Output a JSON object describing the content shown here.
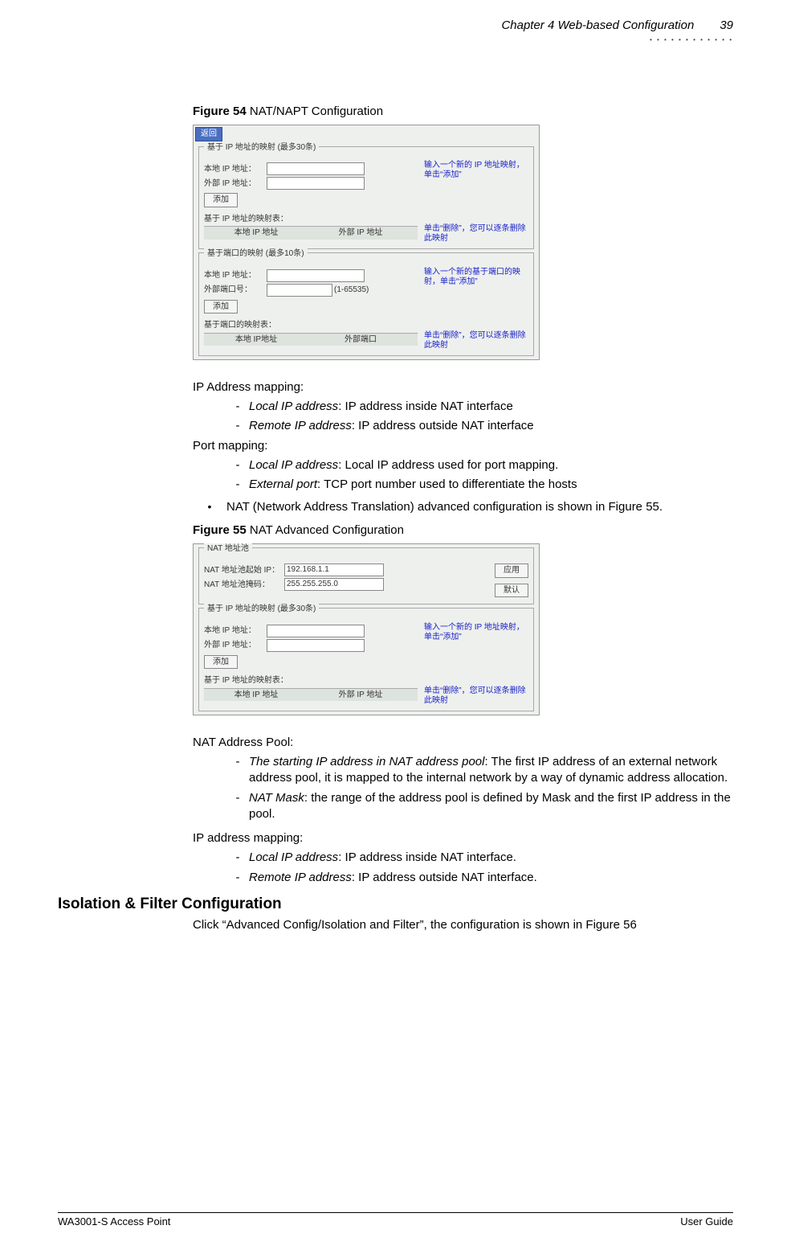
{
  "header": {
    "chapter": "Chapter 4 Web-based Configuration",
    "page": "39"
  },
  "fig54": {
    "label": "Figure 54",
    "title": " NAT/NAPT Configuration",
    "back": "返回",
    "ip_legend": "基于 IP 地址的映射 (最多30条)",
    "local_ip": "本地 IP 地址：",
    "remote_ip": "外部 IP 地址：",
    "add": "添加",
    "hint_add": "输入一个新的 IP 地址映射，单击“添加”",
    "table_title": "基于 IP 地址的映射表：",
    "th_local": "本地 IP 地址",
    "th_remote": "外部 IP 地址",
    "hint_delete": "单击“删除”，您可以逐条删除此映射",
    "port_legend": "基于端口的映射 (最多10条)",
    "port_local_ip": "本地 IP 地址：",
    "port_ext": "外部端口号：",
    "port_range": "(1-65535)",
    "port_hint_add": "输入一个新的基于端口的映射，单击“添加”",
    "port_table_title": "基于端口的映射表：",
    "port_th_local": "本地 IP地址",
    "port_th_ext": "外部端口",
    "port_hint_delete": "单击“删除”，您可以逐条删除此映射"
  },
  "text": {
    "ip_mapping": "IP Address mapping:",
    "ip_local_em": "Local IP address",
    "ip_local_rest": ": IP address inside NAT interface",
    "ip_remote_em": "Remote IP address",
    "ip_remote_rest": ": IP address outside NAT interface",
    "port_mapping": "Port mapping:",
    "port_local_em": "Local IP address",
    "port_local_rest": ": Local IP address used for port mapping.",
    "port_ext_em": "External port",
    "port_ext_rest": ": TCP port number used to differentiate the hosts",
    "nat_bullet": "NAT (Network Address Translation) advanced configuration is shown in Figure 55."
  },
  "fig55": {
    "label": "Figure 55",
    "title": " NAT Advanced Configuration",
    "pool_legend": "NAT 地址池",
    "start_ip_lbl": "NAT 地址池起始 IP：",
    "start_ip_val": "192.168.1.1",
    "mask_lbl": "NAT 地址池掩码：",
    "mask_val": "255.255.255.0",
    "apply": "应用",
    "default": "默认",
    "ip_legend": "基于 IP 地址的映射 (最多30条)",
    "local_ip": "本地 IP 地址：",
    "remote_ip": "外部 IP 地址：",
    "add": "添加",
    "hint_add": "输入一个新的 IP 地址映射，单击“添加”",
    "table_title": "基于 IP 地址的映射表：",
    "th_local": "本地 IP 地址",
    "th_remote": "外部 IP 地址",
    "hint_delete": "单击“删除”，您可以逐条删除此映射"
  },
  "text2": {
    "pool": "NAT Address Pool:",
    "start_em": "The starting IP address in NAT address pool",
    "start_rest": ": The first IP address of an external network address pool, it is mapped to the internal network by a way of dynamic address allocation.",
    "mask_em": "NAT Mask",
    "mask_rest": ": the range of the address pool is defined by Mask and the first IP address in the pool.",
    "ipmap": "IP address mapping:",
    "local_em": "Local IP address",
    "local_rest": ": IP address inside NAT interface.",
    "remote_em": "Remote IP address",
    "remote_rest": ": IP address outside NAT interface."
  },
  "section": {
    "heading": "Isolation & Filter Configuration",
    "body": "Click “Advanced Config/Isolation and Filter”, the configuration is shown in Figure 56"
  },
  "footer": {
    "left": "WA3001-S Access Point",
    "right": "User Guide"
  }
}
